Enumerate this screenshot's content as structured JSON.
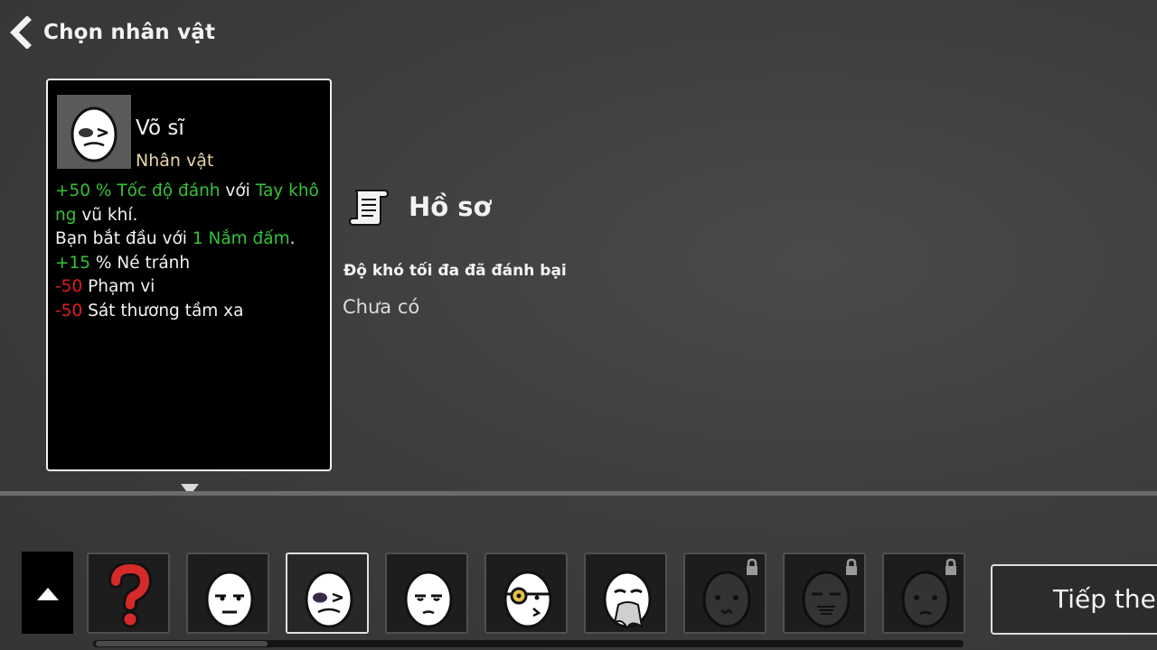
{
  "header": {
    "back_icon": "chevron-left-icon",
    "title": "Chọn nhân vật"
  },
  "selected_character": {
    "portrait_icon": "egg-brawler-icon",
    "name": "Võ sĩ",
    "type": "Nhân vật",
    "stats": {
      "line1": {
        "value": "+50",
        "pct": " % Tốc độ đánh",
        "with": " với ",
        "weapon_a": "Tay khô",
        "weapon_b": "ng",
        "rest": " vũ khí."
      },
      "line2": {
        "prefix": "Bạn bắt đầu với ",
        "item": "1 Nắm đấm",
        "suffix": "."
      },
      "line3": {
        "value": "+15",
        "label": " % Né tránh"
      },
      "line4": {
        "value": "-50",
        "label": " Phạm vi"
      },
      "line5": {
        "value": "-50",
        "label": " Sát thương tầm xa"
      }
    }
  },
  "profile": {
    "icon": "scroll-icon",
    "title": "Hồ sơ",
    "difficulty_label": "Độ khó tối đa đã đánh bại",
    "difficulty_value": "Chưa có"
  },
  "character_bar": {
    "scroll_up_icon": "triangle-up-icon",
    "slots": [
      {
        "name": "random-slot",
        "icon": "question-mark-icon",
        "locked": false,
        "selected": false
      },
      {
        "name": "character-grumpy-egg",
        "icon": "grumpy-egg-icon",
        "locked": false,
        "selected": false
      },
      {
        "name": "character-vo-si",
        "icon": "egg-brawler-icon",
        "locked": false,
        "selected": true
      },
      {
        "name": "character-smug-egg",
        "icon": "smug-egg-icon",
        "locked": false,
        "selected": false
      },
      {
        "name": "character-pirate-egg",
        "icon": "pirate-egg-icon",
        "locked": false,
        "selected": false
      },
      {
        "name": "character-old-egg",
        "icon": "bearded-egg-icon",
        "locked": false,
        "selected": false
      },
      {
        "name": "character-locked-1",
        "icon": "lock-icon",
        "locked": true,
        "selected": false
      },
      {
        "name": "character-locked-2",
        "icon": "lock-icon",
        "locked": true,
        "selected": false
      },
      {
        "name": "character-locked-3",
        "icon": "lock-icon",
        "locked": true,
        "selected": false
      }
    ],
    "scroll_fraction": 0.2
  },
  "next_button": {
    "label": "Tiếp theo"
  },
  "colors": {
    "positive": "#36c23a",
    "negative": "#e11d1d",
    "type_label": "#e6d4a8",
    "background": "#3e3e3e"
  }
}
